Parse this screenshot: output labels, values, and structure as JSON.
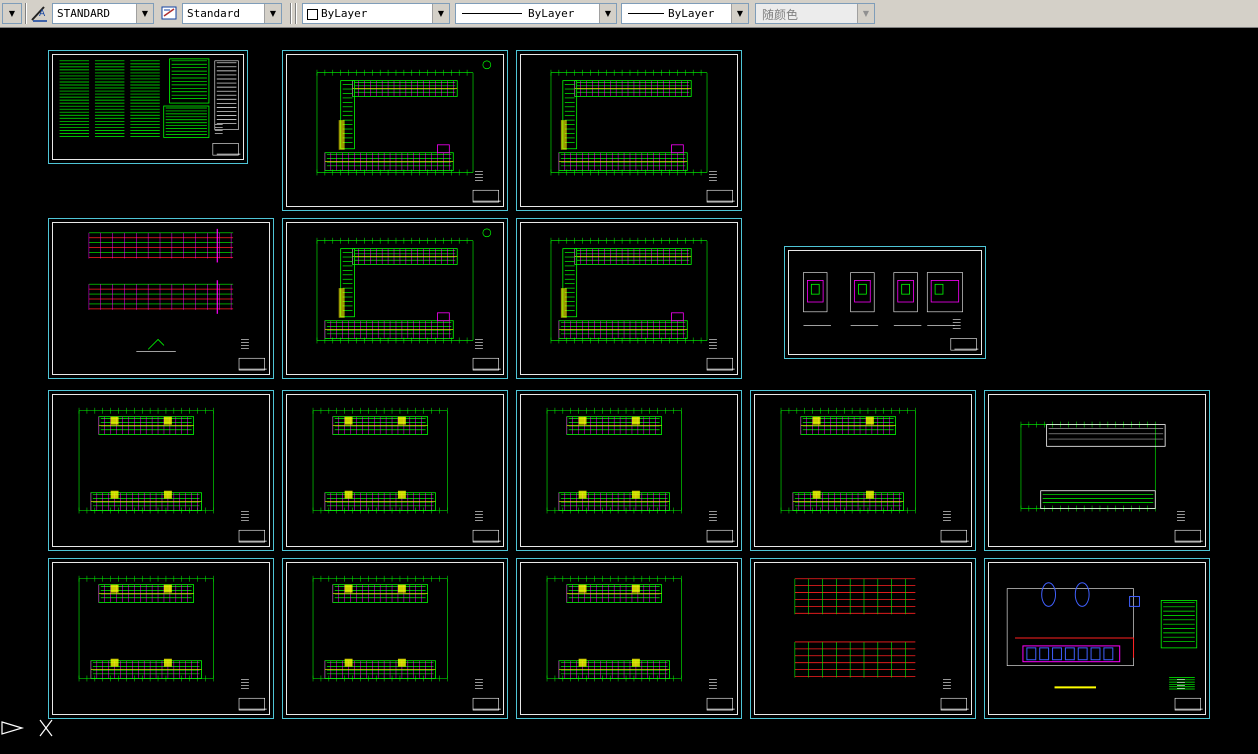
{
  "toolbar": {
    "text_style": "STANDARD",
    "dim_style": "Standard",
    "color": "ByLayer",
    "linetype": "ByLayer",
    "lineweight": "ByLayer",
    "plot_style": "随颜色"
  },
  "colors": {
    "background": "#000000",
    "frame": "#4ec5d6",
    "border": "#e8e8e8",
    "plan_lines": "#00ff00",
    "magenta": "#ff00ff",
    "yellow": "#ffff00",
    "red": "#ff2020",
    "blue": "#4060ff"
  },
  "icons": [
    "text-style-icon",
    "dim-style-icon",
    "ucs-icon"
  ]
}
